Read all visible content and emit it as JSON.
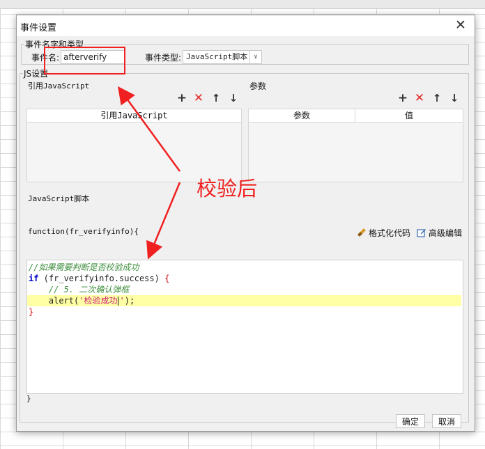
{
  "dialog": {
    "title": "事件设置",
    "close_glyph": "✕",
    "ok_label": "确定",
    "cancel_label": "取消"
  },
  "event_section": {
    "legend": "事件名字和类型",
    "name_label": "事件名:",
    "name_value": "afterverify",
    "type_label": "事件类型:",
    "type_value": "JavaScript脚本"
  },
  "js_section": {
    "legend": "JS设置",
    "ref_js_label": "引用JavaScript",
    "ref_js_column": "引用JavaScript",
    "params_label": "参数",
    "params_columns": [
      "参数",
      "值"
    ],
    "script_label": "JavaScript脚本",
    "func_header": "function(fr_verifyinfo){",
    "format_code_label": "格式化代码",
    "advanced_edit_label": "高级编辑",
    "closing_brace": "}"
  },
  "toolbar_icons": [
    "add-icon",
    "delete-icon",
    "move-up-icon",
    "move-down-icon"
  ],
  "code_lines": [
    {
      "parts": [
        {
          "t": "//如果需要判断是否校验成功",
          "c": "c-comment"
        }
      ]
    },
    {
      "parts": [
        {
          "t": "if",
          "c": "c-kw"
        },
        {
          "t": " (fr_verifyinfo.success) ",
          "c": ""
        },
        {
          "t": "{",
          "c": "c-brace"
        }
      ]
    },
    {
      "parts": [
        {
          "t": "    // 5. 二次确认弹框",
          "c": "c-comment"
        }
      ]
    },
    {
      "parts": [
        {
          "t": "    alert(",
          "c": ""
        },
        {
          "t": "'检验成功",
          "c": "c-str"
        },
        {
          "t": "CARET",
          "c": "caret"
        },
        {
          "t": "'",
          "c": "c-str"
        },
        {
          "t": ");",
          "c": ""
        }
      ],
      "highlight": true
    },
    {
      "parts": [
        {
          "t": "}",
          "c": "c-brace"
        }
      ]
    }
  ],
  "annotation": {
    "text": "校验后",
    "color": "#f02020"
  }
}
